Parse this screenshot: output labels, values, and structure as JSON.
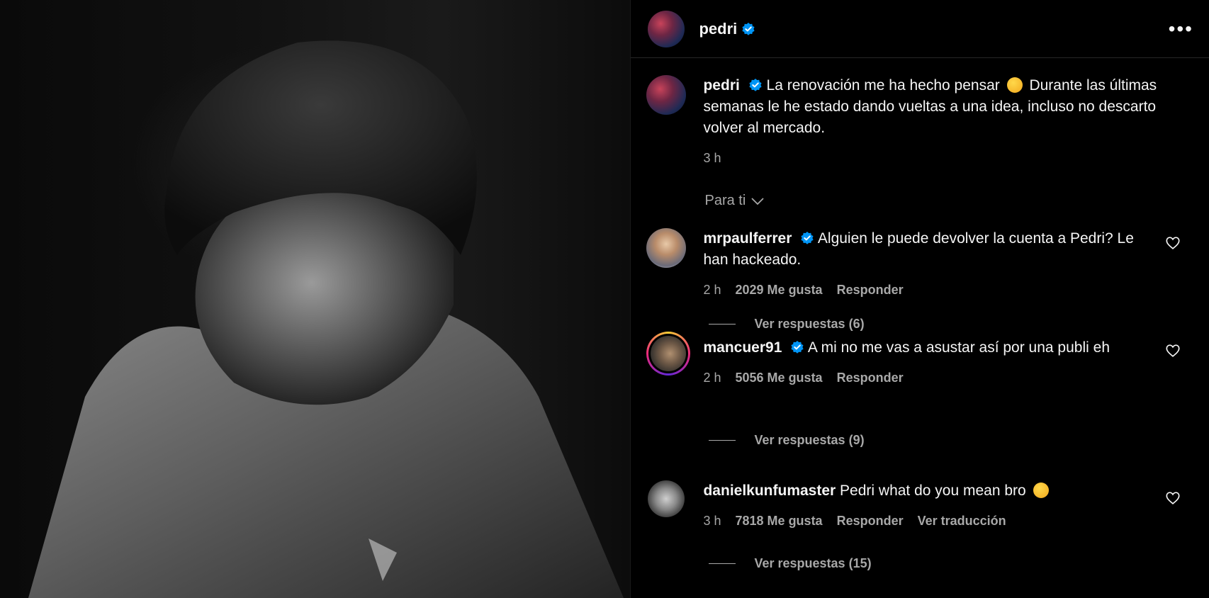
{
  "post": {
    "author": "pedri",
    "caption": "La renovación me ha hecho pensar",
    "caption_rest": "Durante las últimas semanas le he estado dando vueltas a una idea, incluso no descarto volver al mercado.",
    "time": "3 h"
  },
  "sort": {
    "label": "Para ti"
  },
  "comments": [
    {
      "user": "mrpaulferrer",
      "text": "Alguien le puede devolver la cuenta a Pedri? Le han hackeado.",
      "time": "2 h",
      "likes": "2029 Me gusta",
      "reply": "Responder",
      "view_replies": "Ver respuestas (6)"
    },
    {
      "user": "mancuer91",
      "text": "A mi no me vas a asustar así por una publi eh",
      "time": "2 h",
      "likes": "5056 Me gusta",
      "reply": "Responder",
      "view_replies": "Ver respuestas (9)"
    },
    {
      "user": "danielkunfumaster",
      "text": "Pedri what do you mean bro",
      "time": "3 h",
      "likes": "7818 Me gusta",
      "reply": "Responder",
      "translate": "Ver traducción",
      "view_replies": "Ver respuestas (15)"
    }
  ],
  "icons": {
    "verified": "verified-badge-icon",
    "more": "more-options-icon",
    "heart": "heart-icon",
    "chevron": "chevron-down-icon",
    "emoji_thinking": "thinking-face-emoji",
    "emoji_crying": "loudly-crying-emoji"
  },
  "colors": {
    "background": "#000000",
    "text": "#f5f5f5",
    "secondary": "#a8a8a8",
    "verified": "#0095f6",
    "divider": "#262626"
  }
}
